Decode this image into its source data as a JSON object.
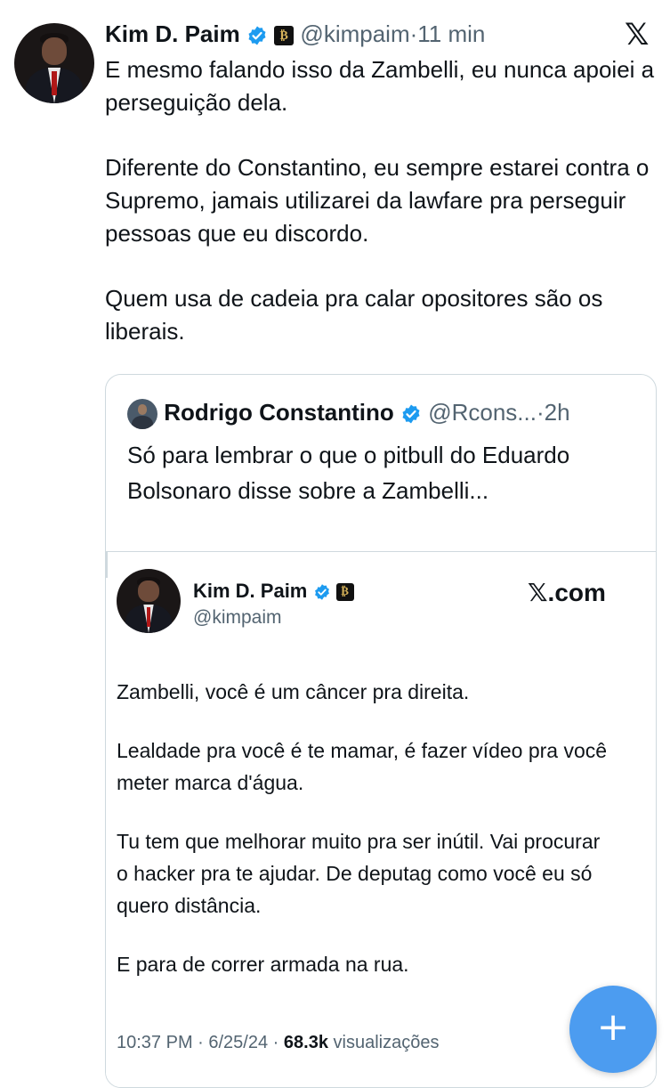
{
  "tweet": {
    "author_name": "Kim D. Paim",
    "handle": "@kimpaim",
    "separator": "·",
    "time": "11 min",
    "paragraphs": [
      "E mesmo falando isso da Zambelli, eu nunca apoiei a perseguição dela.",
      "Diferente do Constantino, eu sempre estarei contra o Supremo, jamais utilizarei da lawfare pra perseguir pessoas que eu discordo.",
      "Quem usa de cadeia pra calar opositores são os liberais."
    ],
    "icons": {
      "verified": "verified-badge-icon",
      "affiliate": "affiliate-badge-icon",
      "platform": "x-logo-icon"
    }
  },
  "quote": {
    "author_name": "Rodrigo Constantino",
    "handle": "@Rcons...",
    "separator": "·",
    "time": "2h",
    "text": "Só para lembrar o que o pitbull do Eduardo Bolsonaro disse sobre a Zambelli..."
  },
  "embedded": {
    "author_name": "Kim D. Paim",
    "handle": "@kimpaim",
    "site_label": "𝕏.com",
    "paragraphs": [
      "Zambelli, você é um câncer pra direita.",
      "Lealdade pra você é te mamar, é fazer vídeo pra você meter marca d'água.",
      "Tu tem que melhorar muito pra ser inútil. Vai procurar o hacker pra te ajudar. De deputag como você eu só quero distância.",
      "E para de correr armada na rua."
    ],
    "timestamp": "10:37 PM · 6/25/24 · ",
    "views_count": "68.3k",
    "views_label": " visualizações"
  },
  "fab": {
    "label": "+"
  },
  "colors": {
    "accent": "#1d9bf0",
    "fab": "#4c9cf0",
    "text": "#0f1419",
    "muted": "#536471",
    "border": "#cfd9de"
  }
}
